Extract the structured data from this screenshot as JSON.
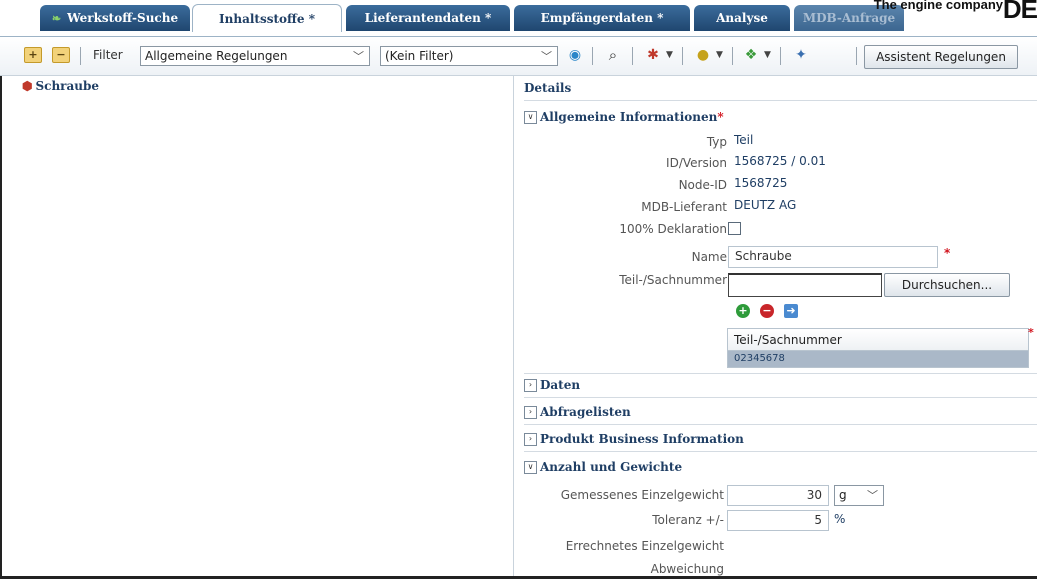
{
  "tabs": [
    {
      "label": "Werkstoff-Suche",
      "icon": "tree-leaf-icon"
    },
    {
      "label": "Inhaltsstoffe *"
    },
    {
      "label": "Lieferantendaten *"
    },
    {
      "label": "Empfängerdaten *"
    },
    {
      "label": "Analyse"
    },
    {
      "label": "MDB-Anfrage"
    }
  ],
  "brand": {
    "tagline": "The engine company",
    "logo": "DE"
  },
  "toolbar": {
    "filter_label": "Filter",
    "filter_value": "Allgemeine Regelungen",
    "filter2_value": "(Kein Filter)",
    "assistant_button": "Assistent Regelungen"
  },
  "tree": {
    "item": "Schraube"
  },
  "details": {
    "title": "Details",
    "general": {
      "heading": "Allgemeine Informationen",
      "req_mark": "*",
      "typ_label": "Typ",
      "typ_value": "Teil",
      "id_label": "ID/Version",
      "id_value": "1568725 / 0.01",
      "node_label": "Node-ID",
      "node_value": "1568725",
      "supplier_label": "MDB-Lieferant",
      "supplier_value": "DEUTZ AG",
      "decl_label": "100% Deklaration",
      "name_label": "Name",
      "name_value": "Schraube",
      "part_label": "Teil-/Sachnummer",
      "browse_button": "Durchsuchen...",
      "table_header": "Teil-/Sachnummer",
      "table_rows": [
        "02345678"
      ]
    },
    "sections": [
      "Daten",
      "Abfragelisten",
      "Produkt Business Information"
    ],
    "weights": {
      "heading": "Anzahl und Gewichte",
      "measured_label": "Gemessenes Einzelgewicht",
      "measured_value": "30",
      "unit": "g",
      "tolerance_label": "Toleranz +/-",
      "tolerance_value": "5",
      "tolerance_unit": "%",
      "calc_label": "Errechnetes Einzelgewicht",
      "deviation_label": "Abweichung"
    }
  },
  "colors": {
    "tab": "#1f466f",
    "accent": "#1f3e64",
    "required": "#d2141e"
  }
}
